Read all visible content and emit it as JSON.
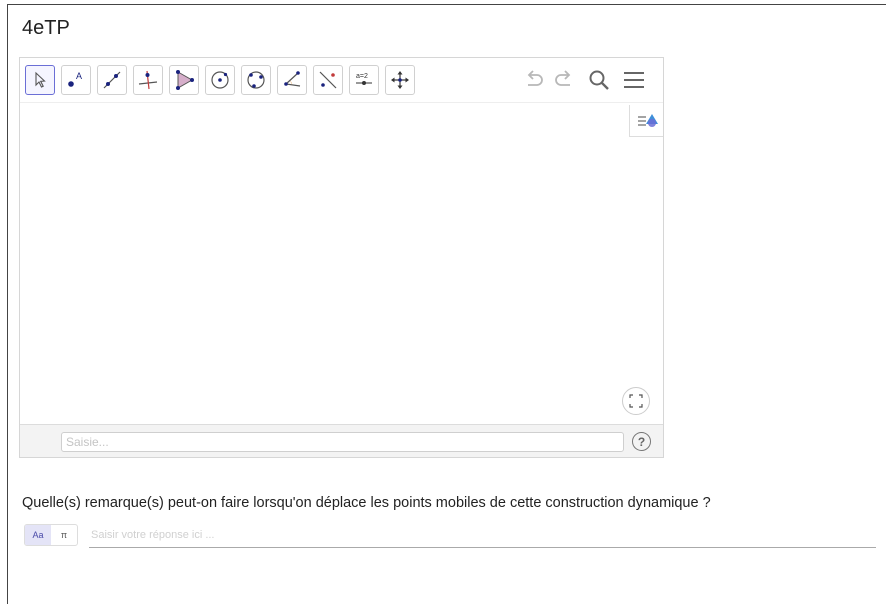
{
  "page": {
    "title": "4eTP"
  },
  "toolbar": {
    "tools": [
      {
        "name": "move-tool",
        "icon": "arrow-pointer-icon",
        "selected": true
      },
      {
        "name": "point-tool",
        "icon": "point-A-icon",
        "label": "A"
      },
      {
        "name": "line-tool",
        "icon": "line-through-points-icon"
      },
      {
        "name": "perpendicular-tool",
        "icon": "perpendicular-line-icon"
      },
      {
        "name": "polygon-tool",
        "icon": "polygon-icon"
      },
      {
        "name": "circle-center-point-tool",
        "icon": "circle-center-icon"
      },
      {
        "name": "circle-three-points-tool",
        "icon": "circle-three-points-icon"
      },
      {
        "name": "angle-tool",
        "icon": "angle-icon"
      },
      {
        "name": "reflect-tool",
        "icon": "reflect-line-icon"
      },
      {
        "name": "slider-tool",
        "icon": "slider-icon",
        "label": "a=2"
      },
      {
        "name": "move-graphics-tool",
        "icon": "move-arrows-icon"
      }
    ],
    "right": [
      "undo-icon",
      "redo-icon",
      "search-icon",
      "menu-icon"
    ]
  },
  "inputbar": {
    "placeholder": "Saisie..."
  },
  "question": {
    "text": "Quelle(s) remarque(s) peut-on faire lorsqu'on déplace les points mobiles de cette construction dynamique ?",
    "toggle": {
      "text_label": "Aa",
      "math_label": "π"
    },
    "answer_placeholder": "Saisir votre réponse ici ..."
  },
  "colors": {
    "accent": "#6b6fd6",
    "point_blue": "#1a237e",
    "polygon_fill": "#c58cb3"
  }
}
